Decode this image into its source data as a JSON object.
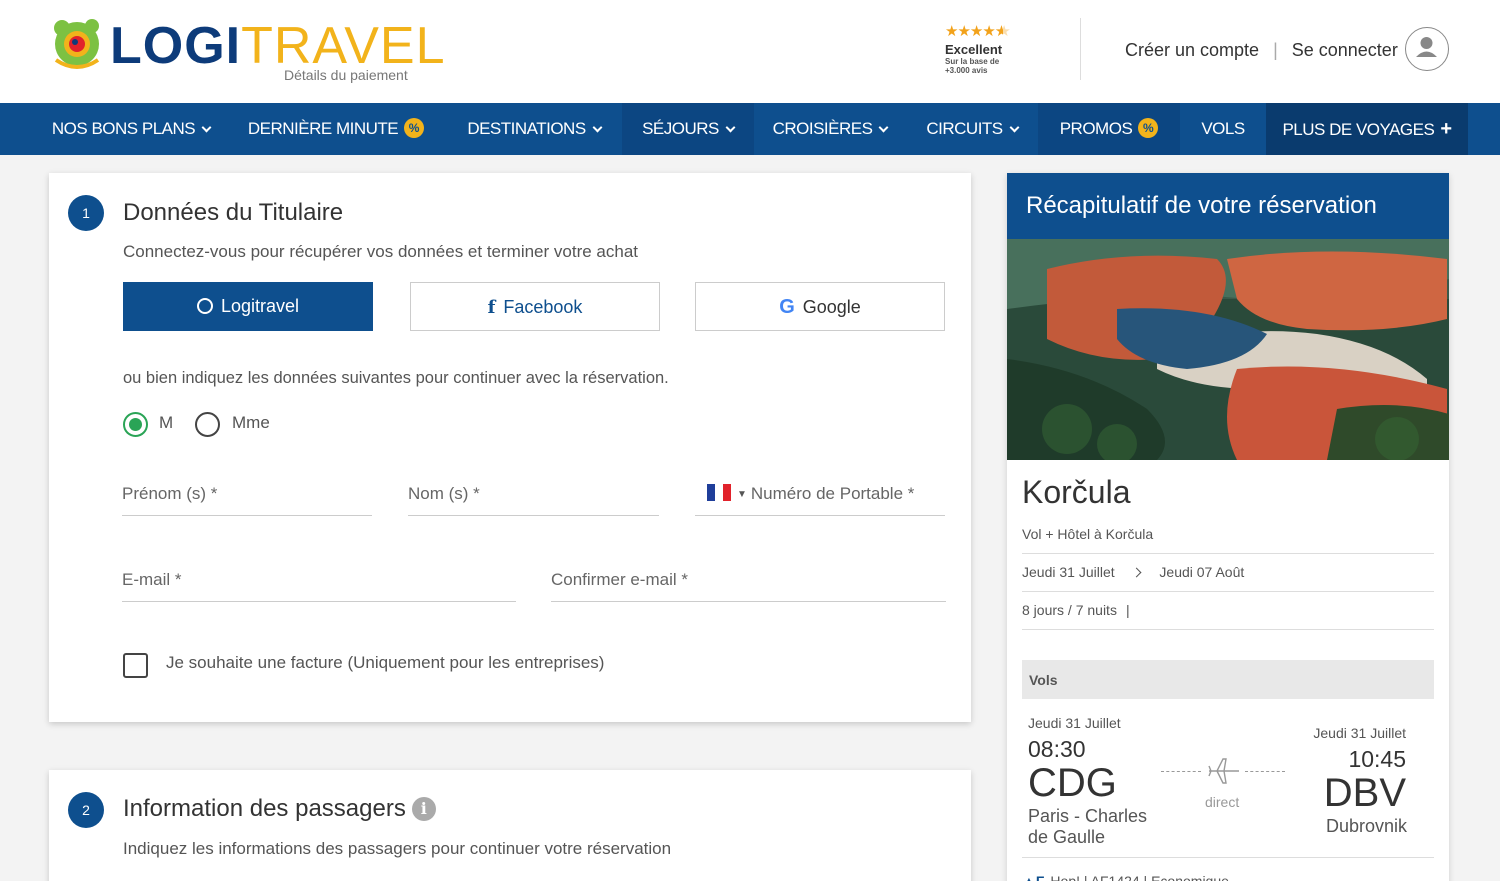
{
  "header": {
    "brand_logi": "LOGI",
    "brand_travel": "TRAVEL",
    "subtitle": "Détails du paiement",
    "rating": {
      "stars": 4.5,
      "label": "Excellent",
      "sub_line1": "Sur la base de",
      "sub_line2": "+3.000 avis"
    },
    "create_account": "Créer un compte",
    "separator": "|",
    "login": "Se connecter"
  },
  "nav": {
    "items": [
      {
        "label": "NOS BONS PLANS"
      },
      {
        "label": "DERNIÈRE MINUTE",
        "badge": "%"
      },
      {
        "label": "DESTINATIONS"
      },
      {
        "label": "SÉJOURS"
      },
      {
        "label": "CROISIÈRES"
      },
      {
        "label": "CIRCUITS"
      },
      {
        "label": "PROMOS",
        "badge": "%"
      },
      {
        "label": "VOLS"
      },
      {
        "label": "PLUS DE VOYAGES",
        "suffix": "+"
      }
    ]
  },
  "holder": {
    "step": "1",
    "title": "Données du Titulaire",
    "subtitle": "Connectez-vous pour récupérer vos données et terminer votre achat",
    "btn_logitravel": "Logitravel",
    "btn_facebook": "Facebook",
    "btn_google": "Google",
    "or_text": "ou bien indiquez les données suivantes pour continuer avec la réservation.",
    "gender_m": "M",
    "gender_mme": "Mme",
    "gender_selected": "M",
    "first_name": "Prénom (s) *",
    "last_name": "Nom (s) *",
    "phone": "Numéro de Portable *",
    "email": "E-mail *",
    "confirm_email": "Confirmer e-mail *",
    "invoice_label": "Je souhaite une facture (Uniquement pour les entreprises)",
    "invoice_checked": false
  },
  "passengers": {
    "step": "2",
    "title": "Information des passagers",
    "subtitle": "Indiquez les informations des passagers pour continuer votre réservation"
  },
  "summary": {
    "heading": "Récapitulatif de votre réservation",
    "destination": "Korčula",
    "package": "Vol + Hôtel à Korčula",
    "date_from": "Jeudi 31 Juillet",
    "date_to": "Jeudi 07 Août",
    "duration": "8 jours / 7 nuits",
    "duration_sep": "|",
    "flights_label": "Vols",
    "flight": {
      "dep_date": "Jeudi 31 Juillet",
      "dep_time": "08:30",
      "dep_code": "CDG",
      "dep_city": "Paris - Charles de Gaulle",
      "stops": "direct",
      "arr_date": "Jeudi 31 Juillet",
      "arr_time": "10:45",
      "arr_code": "DBV",
      "arr_city": "Dubrovnik",
      "airline_line": "Hop! | AF1424 | Economique"
    }
  },
  "colors": {
    "brand_blue": "#0e4f8e",
    "brand_yellow": "#f2b31b",
    "radio_green": "#2aa456"
  }
}
